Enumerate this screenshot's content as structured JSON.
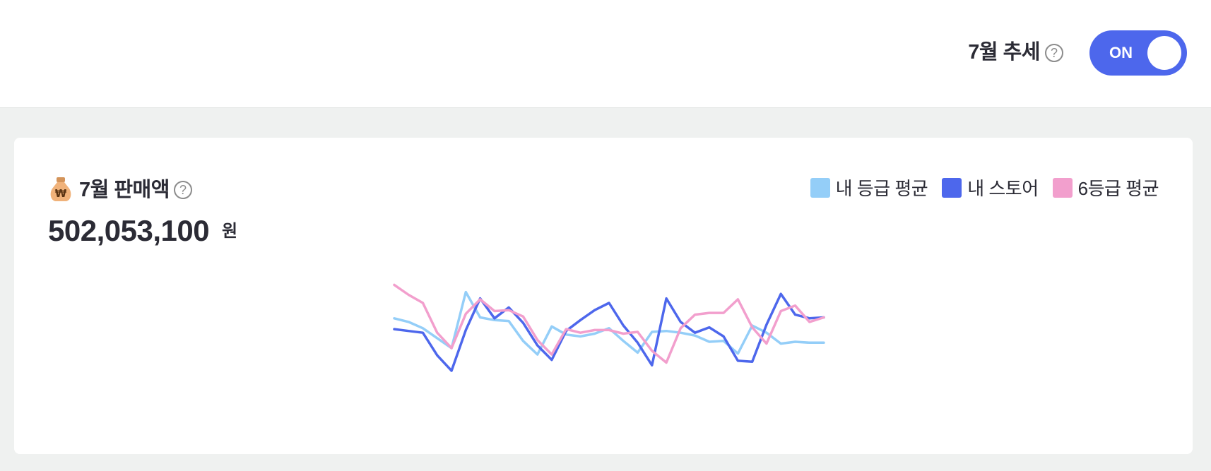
{
  "header": {
    "trend_label": "7월 추세",
    "help_symbol": "?",
    "toggle_label": "ON"
  },
  "card": {
    "title": "7월 판매액",
    "help_symbol": "?",
    "amount": "502,053,100",
    "unit": "원",
    "icon": "money-bag-icon"
  },
  "legend": [
    {
      "label": "내 등급 평균",
      "color": "#94cef8"
    },
    {
      "label": "내 스토어",
      "color": "#4d67ec"
    },
    {
      "label": "6등급 평균",
      "color": "#f29fcd"
    }
  ],
  "colors": {
    "accent": "#4d67ec",
    "light_blue": "#94cef8",
    "pink": "#f29fcd"
  },
  "chart_data": {
    "type": "line",
    "x": [
      1,
      2,
      3,
      4,
      5,
      6,
      7,
      8,
      9,
      10,
      11,
      12,
      13,
      14,
      15,
      16,
      17,
      18,
      19,
      20,
      21,
      22,
      23,
      24,
      25,
      26,
      27,
      28,
      29,
      30,
      31
    ],
    "ylim": [
      0,
      100
    ],
    "grid": false,
    "legend_position": "top-right",
    "series": [
      {
        "name": "내 등급 평균",
        "color": "#94cef8",
        "values": [
          58,
          54,
          47,
          36,
          25,
          87,
          59,
          56,
          55,
          33,
          18,
          49,
          40,
          38,
          41,
          47,
          33,
          20,
          43,
          44,
          42,
          39,
          32,
          33,
          19,
          50,
          42,
          30,
          32,
          31,
          31
        ]
      },
      {
        "name": "내 스토어",
        "color": "#4d67ec",
        "values": [
          46,
          44,
          42,
          17,
          0,
          45,
          80,
          58,
          70,
          53,
          28,
          12,
          44,
          56,
          67,
          75,
          50,
          31,
          6,
          80,
          54,
          42,
          48,
          38,
          11,
          10,
          51,
          85,
          62,
          58,
          59
        ]
      },
      {
        "name": "6등급 평균",
        "color": "#f29fcd",
        "values": [
          95,
          84,
          75,
          42,
          25,
          63,
          79,
          66,
          67,
          60,
          34,
          18,
          46,
          42,
          45,
          45,
          41,
          43,
          22,
          9,
          47,
          62,
          64,
          64,
          79,
          48,
          30,
          66,
          72,
          54,
          59
        ]
      }
    ]
  }
}
